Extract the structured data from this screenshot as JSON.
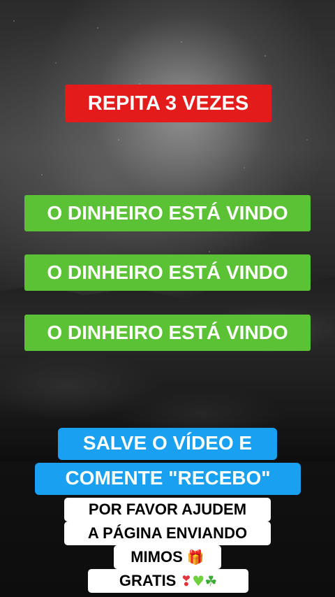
{
  "header": {
    "label": "REPITA 3 VEZES",
    "color": "#e31b1b"
  },
  "affirmations": [
    {
      "label": "O DINHEIRO ESTÁ VINDO"
    },
    {
      "label": "O DINHEIRO ESTÁ VINDO"
    },
    {
      "label": "O DINHEIRO ESTÁ VINDO"
    }
  ],
  "affirmation_color": "#5bc236",
  "call_to_action": {
    "line1": "SALVE O VÍDEO E",
    "line2": "COMENTE \"RECEBO\"",
    "color": "#1aa0f0"
  },
  "request": {
    "line1": "POR FAVOR AJUDEM",
    "line2": "A PÁGINA ENVIANDO",
    "line3": "MIMOS",
    "line4": "GRATIS",
    "icons": [
      "gift-icon",
      "heart-exclamation-icon",
      "green-heart-icon",
      "four-leaf-clover-icon"
    ]
  }
}
